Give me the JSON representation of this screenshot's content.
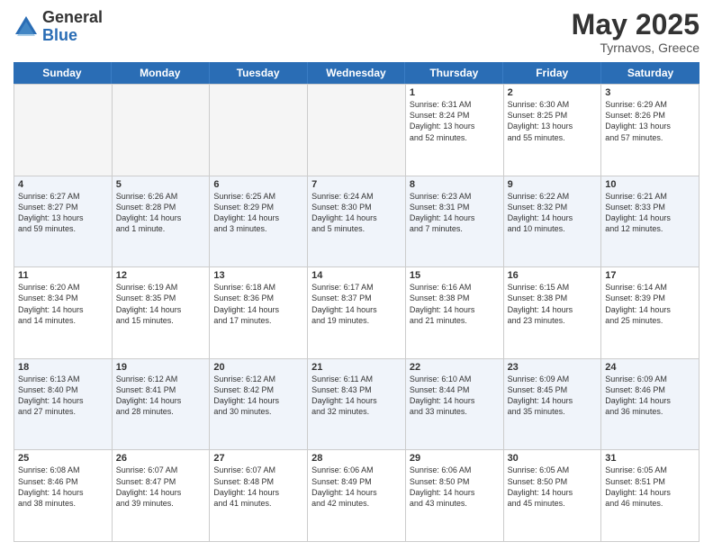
{
  "logo": {
    "general": "General",
    "blue": "Blue"
  },
  "title": {
    "month_year": "May 2025",
    "location": "Tyrnavos, Greece"
  },
  "days": [
    "Sunday",
    "Monday",
    "Tuesday",
    "Wednesday",
    "Thursday",
    "Friday",
    "Saturday"
  ],
  "weeks": [
    [
      {
        "day": "",
        "detail": ""
      },
      {
        "day": "",
        "detail": ""
      },
      {
        "day": "",
        "detail": ""
      },
      {
        "day": "",
        "detail": ""
      },
      {
        "day": "1",
        "detail": "Sunrise: 6:31 AM\nSunset: 8:24 PM\nDaylight: 13 hours\nand 52 minutes."
      },
      {
        "day": "2",
        "detail": "Sunrise: 6:30 AM\nSunset: 8:25 PM\nDaylight: 13 hours\nand 55 minutes."
      },
      {
        "day": "3",
        "detail": "Sunrise: 6:29 AM\nSunset: 8:26 PM\nDaylight: 13 hours\nand 57 minutes."
      }
    ],
    [
      {
        "day": "4",
        "detail": "Sunrise: 6:27 AM\nSunset: 8:27 PM\nDaylight: 13 hours\nand 59 minutes."
      },
      {
        "day": "5",
        "detail": "Sunrise: 6:26 AM\nSunset: 8:28 PM\nDaylight: 14 hours\nand 1 minute."
      },
      {
        "day": "6",
        "detail": "Sunrise: 6:25 AM\nSunset: 8:29 PM\nDaylight: 14 hours\nand 3 minutes."
      },
      {
        "day": "7",
        "detail": "Sunrise: 6:24 AM\nSunset: 8:30 PM\nDaylight: 14 hours\nand 5 minutes."
      },
      {
        "day": "8",
        "detail": "Sunrise: 6:23 AM\nSunset: 8:31 PM\nDaylight: 14 hours\nand 7 minutes."
      },
      {
        "day": "9",
        "detail": "Sunrise: 6:22 AM\nSunset: 8:32 PM\nDaylight: 14 hours\nand 10 minutes."
      },
      {
        "day": "10",
        "detail": "Sunrise: 6:21 AM\nSunset: 8:33 PM\nDaylight: 14 hours\nand 12 minutes."
      }
    ],
    [
      {
        "day": "11",
        "detail": "Sunrise: 6:20 AM\nSunset: 8:34 PM\nDaylight: 14 hours\nand 14 minutes."
      },
      {
        "day": "12",
        "detail": "Sunrise: 6:19 AM\nSunset: 8:35 PM\nDaylight: 14 hours\nand 15 minutes."
      },
      {
        "day": "13",
        "detail": "Sunrise: 6:18 AM\nSunset: 8:36 PM\nDaylight: 14 hours\nand 17 minutes."
      },
      {
        "day": "14",
        "detail": "Sunrise: 6:17 AM\nSunset: 8:37 PM\nDaylight: 14 hours\nand 19 minutes."
      },
      {
        "day": "15",
        "detail": "Sunrise: 6:16 AM\nSunset: 8:38 PM\nDaylight: 14 hours\nand 21 minutes."
      },
      {
        "day": "16",
        "detail": "Sunrise: 6:15 AM\nSunset: 8:38 PM\nDaylight: 14 hours\nand 23 minutes."
      },
      {
        "day": "17",
        "detail": "Sunrise: 6:14 AM\nSunset: 8:39 PM\nDaylight: 14 hours\nand 25 minutes."
      }
    ],
    [
      {
        "day": "18",
        "detail": "Sunrise: 6:13 AM\nSunset: 8:40 PM\nDaylight: 14 hours\nand 27 minutes."
      },
      {
        "day": "19",
        "detail": "Sunrise: 6:12 AM\nSunset: 8:41 PM\nDaylight: 14 hours\nand 28 minutes."
      },
      {
        "day": "20",
        "detail": "Sunrise: 6:12 AM\nSunset: 8:42 PM\nDaylight: 14 hours\nand 30 minutes."
      },
      {
        "day": "21",
        "detail": "Sunrise: 6:11 AM\nSunset: 8:43 PM\nDaylight: 14 hours\nand 32 minutes."
      },
      {
        "day": "22",
        "detail": "Sunrise: 6:10 AM\nSunset: 8:44 PM\nDaylight: 14 hours\nand 33 minutes."
      },
      {
        "day": "23",
        "detail": "Sunrise: 6:09 AM\nSunset: 8:45 PM\nDaylight: 14 hours\nand 35 minutes."
      },
      {
        "day": "24",
        "detail": "Sunrise: 6:09 AM\nSunset: 8:46 PM\nDaylight: 14 hours\nand 36 minutes."
      }
    ],
    [
      {
        "day": "25",
        "detail": "Sunrise: 6:08 AM\nSunset: 8:46 PM\nDaylight: 14 hours\nand 38 minutes."
      },
      {
        "day": "26",
        "detail": "Sunrise: 6:07 AM\nSunset: 8:47 PM\nDaylight: 14 hours\nand 39 minutes."
      },
      {
        "day": "27",
        "detail": "Sunrise: 6:07 AM\nSunset: 8:48 PM\nDaylight: 14 hours\nand 41 minutes."
      },
      {
        "day": "28",
        "detail": "Sunrise: 6:06 AM\nSunset: 8:49 PM\nDaylight: 14 hours\nand 42 minutes."
      },
      {
        "day": "29",
        "detail": "Sunrise: 6:06 AM\nSunset: 8:50 PM\nDaylight: 14 hours\nand 43 minutes."
      },
      {
        "day": "30",
        "detail": "Sunrise: 6:05 AM\nSunset: 8:50 PM\nDaylight: 14 hours\nand 45 minutes."
      },
      {
        "day": "31",
        "detail": "Sunrise: 6:05 AM\nSunset: 8:51 PM\nDaylight: 14 hours\nand 46 minutes."
      }
    ]
  ]
}
